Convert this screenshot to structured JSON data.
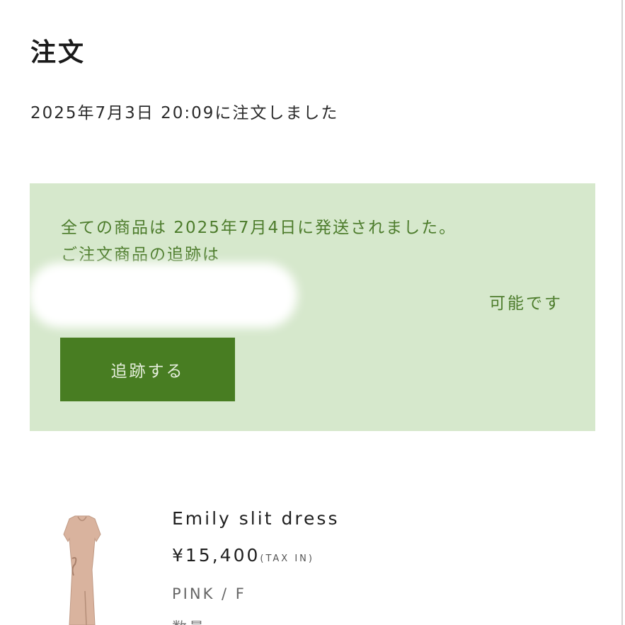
{
  "header": {
    "title": "注文",
    "order_placed": "2025年7月3日 20:09に注文しました"
  },
  "notice": {
    "line1": "全ての商品は 2025年7月4日に発送されました。",
    "line2": "ご注文商品の追跡は",
    "line3": "可能です",
    "track_button_label": "追跡する"
  },
  "product": {
    "name": "Emily slit dress",
    "price": "¥15,400",
    "tax_note": "(TAX IN)",
    "variant": "PINK / F",
    "quantity_partial": "数量"
  },
  "colors": {
    "notice_bg": "#d6e8cc",
    "notice_text": "#4d7c2c",
    "button_bg": "#487d22",
    "product_color": "#d9b39e"
  },
  "icons": {
    "product_image": "dress-thumbnail"
  }
}
